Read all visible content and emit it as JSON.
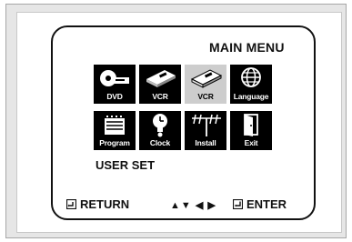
{
  "menu": {
    "title": "MAIN MENU",
    "tiles_row1": [
      {
        "label": "DVD",
        "icon": "dvd-disc-icon"
      },
      {
        "label": "VCR",
        "icon": "vcr-tape-icon"
      },
      {
        "label": "VCR",
        "icon": "vcr-tape-selected-icon",
        "selected": true
      },
      {
        "label": "Language",
        "icon": "globe-icon"
      }
    ],
    "tiles_row2": [
      {
        "label": "Program",
        "icon": "calendar-icon"
      },
      {
        "label": "Clock",
        "icon": "clock-icon"
      },
      {
        "label": "Install",
        "icon": "antenna-icon"
      },
      {
        "label": "Exit",
        "icon": "exit-door-icon"
      }
    ],
    "current_item_label": "USER SET"
  },
  "footer": {
    "return_label": "RETURN",
    "nav_arrows": "▲▼ ◀ ▶",
    "enter_label": "ENTER"
  },
  "colors": {
    "tile_bg": "#000000",
    "tile_selected_bg": "#cdcdcd",
    "frame_gray": "#e6e6e6"
  }
}
